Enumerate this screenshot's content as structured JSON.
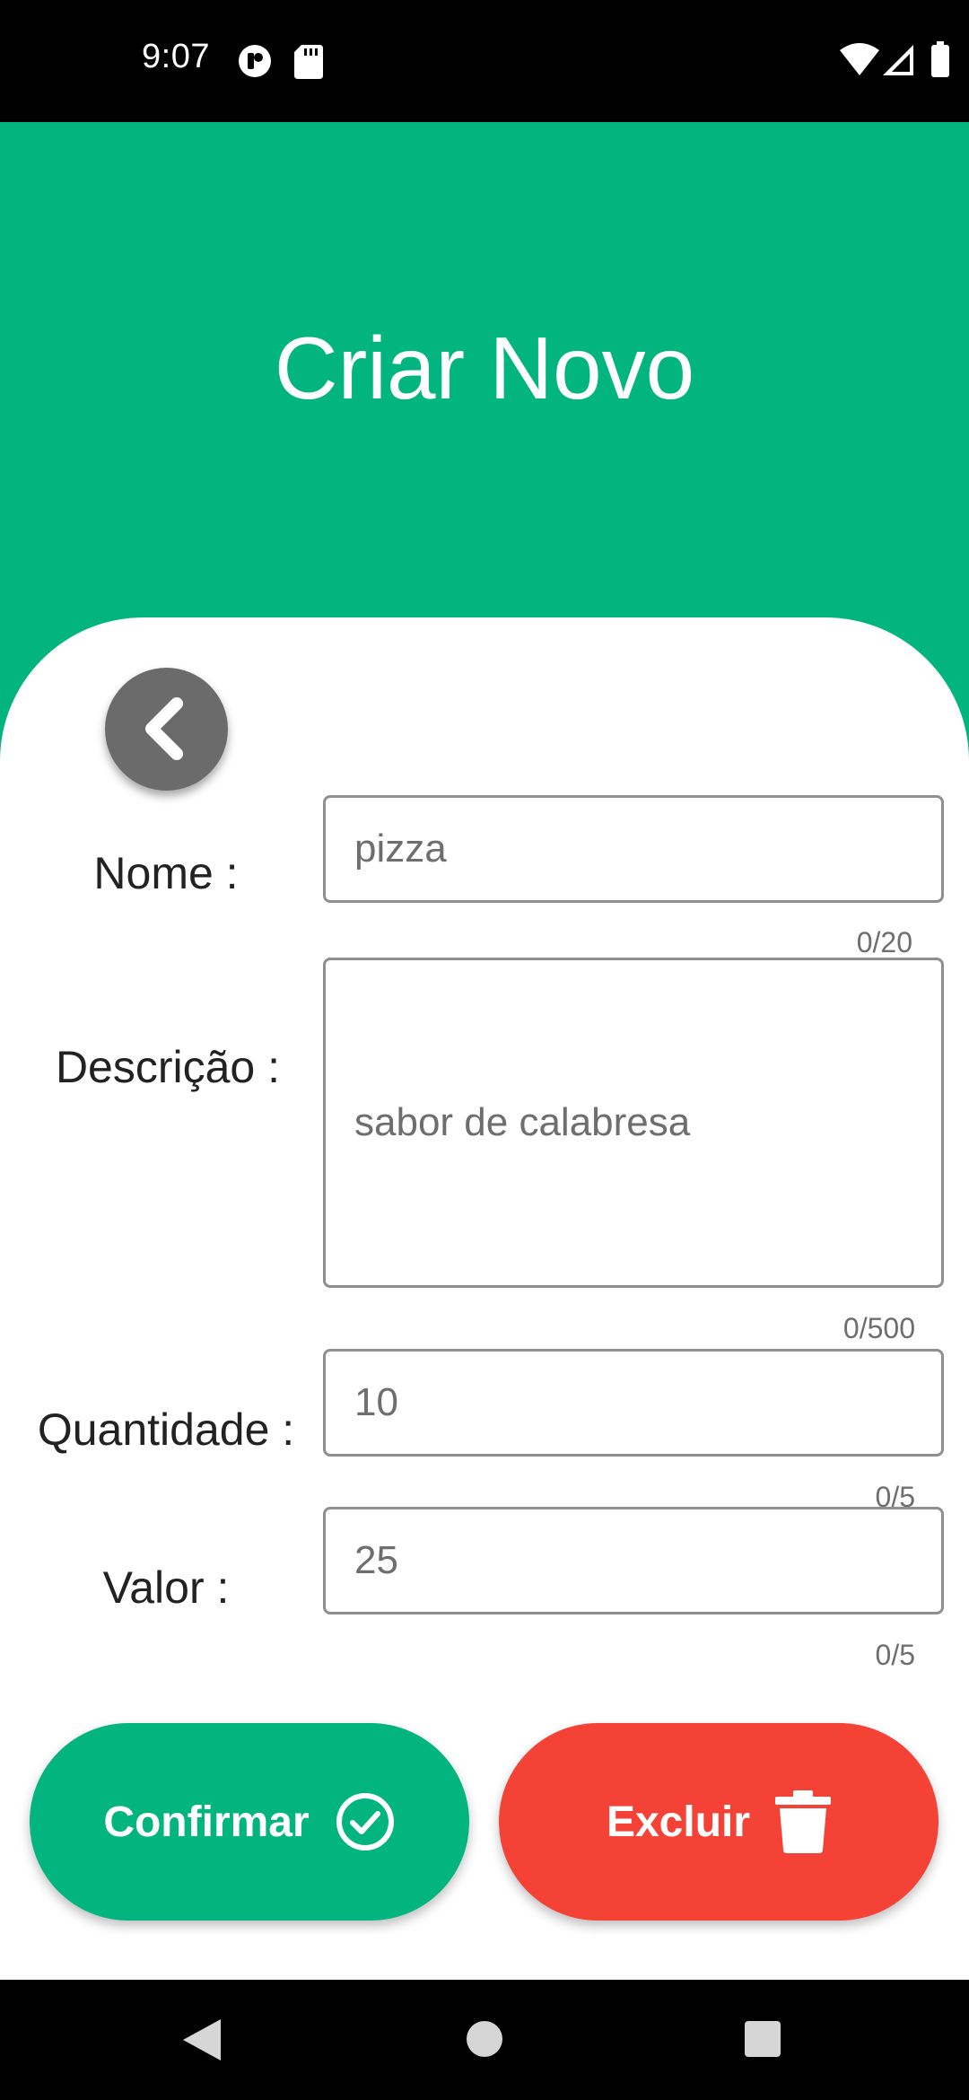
{
  "status_bar": {
    "time": "9:07",
    "icons": [
      "privacy-icon",
      "sd-card-icon",
      "wifi-icon",
      "cellular-signal-icon",
      "battery-icon"
    ]
  },
  "header": {
    "title": "Criar Novo",
    "background_color": "#02b47e"
  },
  "form": {
    "back_icon": "chevron-left-icon",
    "fields": [
      {
        "label": "Nome :",
        "value": "pizza",
        "counter": "0/20"
      },
      {
        "label": "Descrição :",
        "value": "sabor de calabresa",
        "counter": "0/500"
      },
      {
        "label": "Quantidade :",
        "value": "10",
        "counter": "0/5"
      },
      {
        "label": "Valor :",
        "value": "25",
        "counter": "0/5"
      }
    ]
  },
  "actions": {
    "confirm": {
      "label": "Confirmar",
      "icon": "check-circle-icon",
      "color": "#02b47e"
    },
    "delete": {
      "label": "Excluir",
      "icon": "trash-icon",
      "color": "#f44336"
    }
  },
  "nav_bar": {
    "items": [
      "back-triangle-icon",
      "home-circle-icon",
      "recents-square-icon"
    ]
  }
}
